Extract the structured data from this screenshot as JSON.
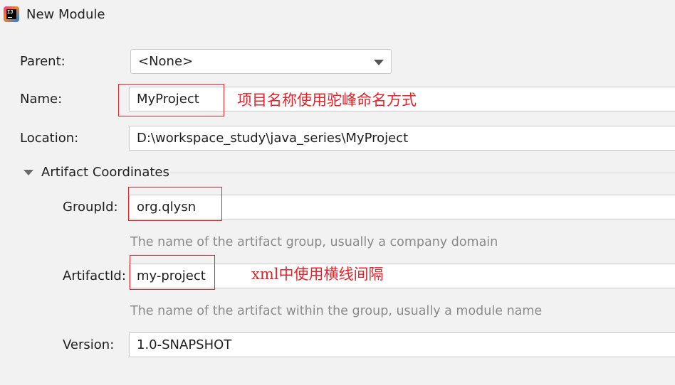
{
  "window": {
    "title": "New Module",
    "app_icon": "intellij-idea-icon"
  },
  "form": {
    "parent": {
      "label": "Parent:",
      "value": "<None>"
    },
    "name": {
      "label": "Name:",
      "value": "MyProject"
    },
    "location": {
      "label": "Location:",
      "value": "D:\\workspace_study\\java_series\\MyProject"
    },
    "artifact_section": {
      "title": "Artifact Coordinates"
    },
    "group_id": {
      "label": "GroupId:",
      "value": "org.qlysn",
      "hint": "The name of the artifact group, usually a company domain"
    },
    "artifact_id": {
      "label": "ArtifactId:",
      "value": "my-project",
      "hint": "The name of the artifact within the group, usually a module name"
    },
    "version": {
      "label": "Version:",
      "value": "1.0-SNAPSHOT"
    }
  },
  "annotations": {
    "name_note": "项目名称使用驼峰命名方式",
    "artifact_note": "xml中使用横线间隔",
    "color": "#e8222a"
  }
}
